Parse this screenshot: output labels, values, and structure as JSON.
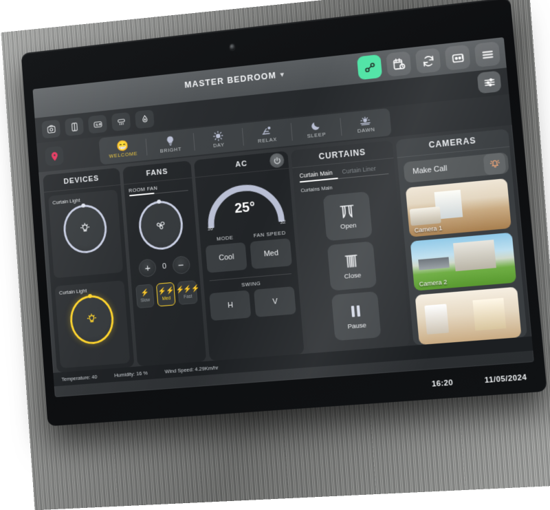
{
  "header": {
    "room_title": "MASTER BEDROOM",
    "chevron": "chevron-down-icon"
  },
  "top_actions": [
    {
      "name": "link-devices-button",
      "icon": "link-icon",
      "accent": "#4fe3a5",
      "active": true
    },
    {
      "name": "schedule-button",
      "icon": "calendar-clock-icon",
      "active": false
    },
    {
      "name": "sync-button",
      "icon": "refresh-icon",
      "active": false
    },
    {
      "name": "automation-button",
      "icon": "robot-icon",
      "active": false
    },
    {
      "name": "menu-button",
      "icon": "hamburger-icon",
      "active": false
    }
  ],
  "device_chips": [
    {
      "name": "camera-chip",
      "icon": "camera-icon"
    },
    {
      "name": "door-chip",
      "icon": "door-icon"
    },
    {
      "name": "thermostat-chip",
      "icon": "thermostat-icon"
    },
    {
      "name": "smoke-detector-chip",
      "icon": "smoke-detector-icon"
    },
    {
      "name": "water-sensor-chip",
      "icon": "water-drop-icon"
    }
  ],
  "settings_button": {
    "label": "",
    "icon": "sliders-icon"
  },
  "location_pin": {
    "icon": "location-pin-icon",
    "color": "#e8305a"
  },
  "scenes": [
    {
      "label": "WELCOME",
      "icon": "smiley-face-emoji",
      "active": true
    },
    {
      "label": "BRIGHT",
      "icon": "lightbulb-icon",
      "active": false
    },
    {
      "label": "DAY",
      "icon": "sun-icon",
      "active": false
    },
    {
      "label": "RELAX",
      "icon": "lounge-chair-icon",
      "active": false
    },
    {
      "label": "SLEEP",
      "icon": "moon-icon",
      "active": false
    },
    {
      "label": "DAWN",
      "icon": "sunrise-icon",
      "active": false
    }
  ],
  "devices": {
    "title": "DEVICES",
    "items": [
      {
        "label": "Curtain Light",
        "state": "off",
        "icon": "light-icon",
        "ring_color": "#c9cfe4"
      },
      {
        "label": "Curtain Light",
        "state": "on",
        "icon": "light-icon",
        "ring_color": "#ffd42a"
      }
    ]
  },
  "fans": {
    "title": "FANS",
    "tab": "ROOM FAN",
    "dial_icon": "fan-blade-icon",
    "value": "0",
    "increase_label": "+",
    "decrease_label": "−",
    "speeds": [
      {
        "label": "Slow",
        "bolts": "⚡",
        "active": false
      },
      {
        "label": "Med",
        "bolts": "⚡⚡",
        "active": true
      },
      {
        "label": "Fast",
        "bolts": "⚡⚡⚡",
        "active": false
      }
    ]
  },
  "ac": {
    "title": "AC",
    "power_icon": "power-icon",
    "temperature": "25°",
    "min": "16",
    "max": "32",
    "mode_label": "MODE",
    "mode_value": "Cool",
    "fan_speed_label": "FAN SPEED",
    "fan_speed_value": "Med",
    "swing_label": "SWING",
    "swing_options": [
      "H",
      "V"
    ]
  },
  "curtains": {
    "title": "CURTAINS",
    "tabs": [
      {
        "label": "Curtain Main",
        "active": true
      },
      {
        "label": "Curtain Liner",
        "active": false
      }
    ],
    "subtitle": "Curtains Main",
    "buttons": [
      {
        "label": "Open",
        "icon": "curtain-open-icon"
      },
      {
        "label": "Close",
        "icon": "curtain-closed-icon"
      },
      {
        "label": "Pause",
        "icon": "pause-icon"
      }
    ]
  },
  "cameras": {
    "title": "CAMERAS",
    "make_call_label": "Make Call",
    "bell_icon": "ringing-bell-icon",
    "bell_color": "#e8a175",
    "tiles": [
      {
        "label": "Camera 1",
        "scene": "bedroom-interior"
      },
      {
        "label": "Camera 2",
        "scene": "house-exterior"
      },
      {
        "label": "",
        "scene": "lobby-interior"
      }
    ]
  },
  "weather": {
    "temperature": "Temperature: 40",
    "humidity": "Humidity: 16 %",
    "wind_speed": "Wind Speed: 4.29Km/hr"
  },
  "footer": {
    "time": "16:20",
    "date": "11/05/2024"
  }
}
